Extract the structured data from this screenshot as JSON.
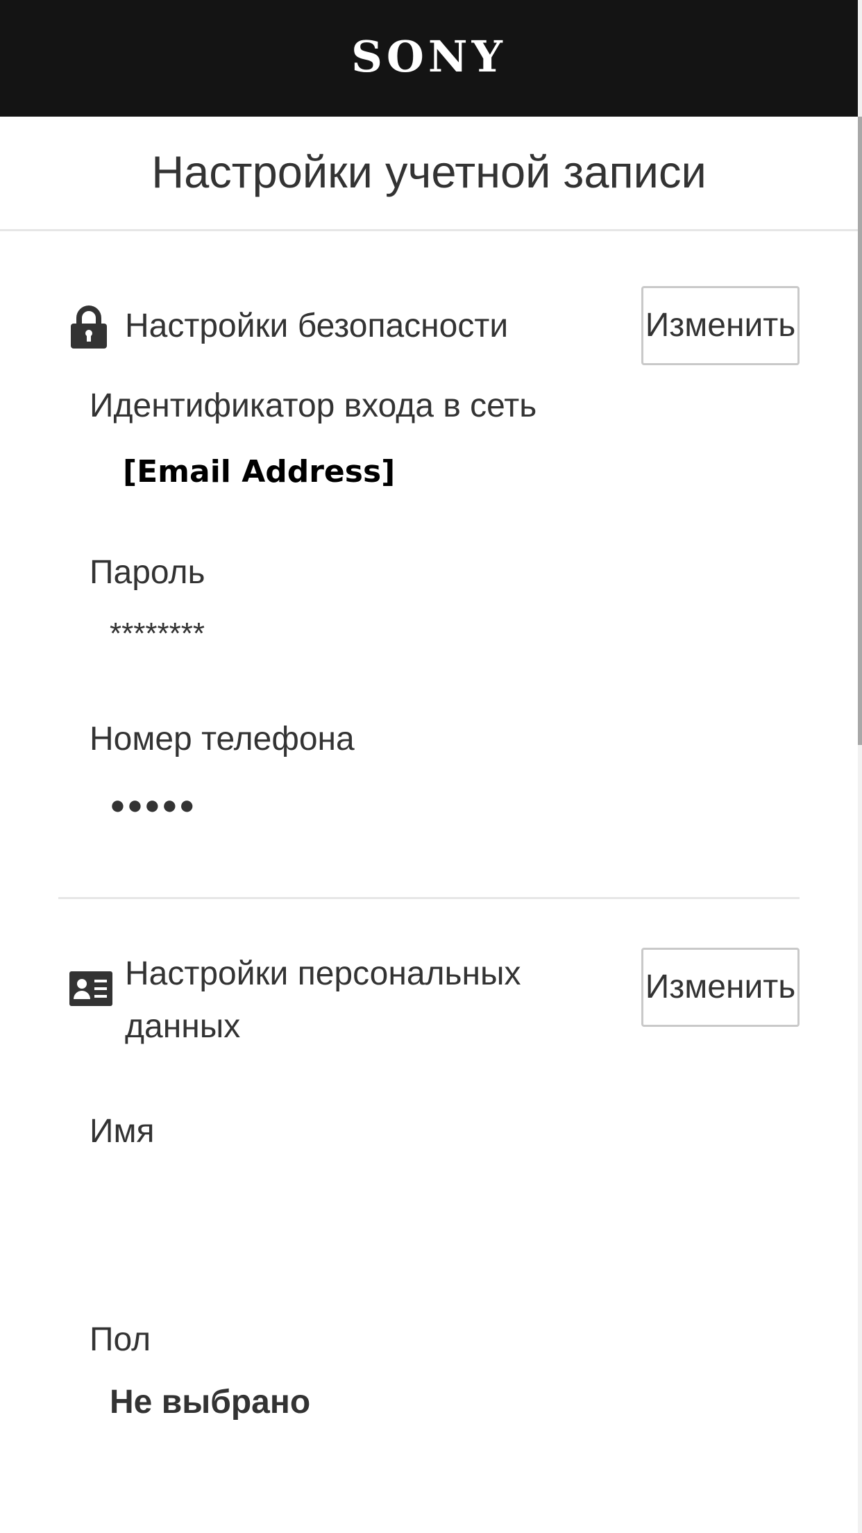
{
  "header": {
    "logo_text": "SONY"
  },
  "page_title": "Настройки учетной записи",
  "security": {
    "icon": "lock-icon",
    "title": "Настройки безопасности",
    "edit_label": "Изменить",
    "fields": {
      "signin_id_label": "Идентификатор входа в сеть",
      "signin_id_value": "[Email Address]",
      "password_label": "Пароль",
      "password_value": "********",
      "phone_label": "Номер телефона",
      "phone_value": "●●●●●"
    }
  },
  "personal": {
    "icon": "id-card-icon",
    "title": "Настройки персональных данных",
    "edit_label": "Изменить",
    "fields": {
      "name_label": "Имя",
      "name_value": "",
      "gender_label": "Пол",
      "gender_value": "Не выбрано"
    }
  },
  "colors": {
    "header_bg": "#141414",
    "text": "#333333",
    "divider": "#e6e6e6",
    "button_border": "#c9c9c9"
  }
}
